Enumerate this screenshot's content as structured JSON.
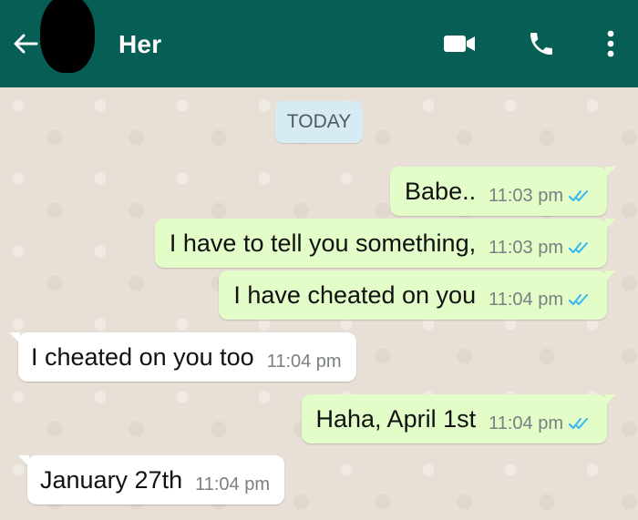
{
  "header": {
    "contact_name": "Her",
    "back_icon": "arrow-left-icon",
    "video_icon": "video-call-icon",
    "call_icon": "phone-icon",
    "menu_icon": "more-vertical-icon",
    "bar_color": "#075e54"
  },
  "chat": {
    "date_divider": "TODAY",
    "read_tick_color": "#34b7f1",
    "messages": [
      {
        "direction": "outgoing",
        "text": "Babe..",
        "time": "11:03 pm",
        "status": "read"
      },
      {
        "direction": "outgoing",
        "text": "I have to tell you something,",
        "time": "11:03 pm",
        "status": "read"
      },
      {
        "direction": "outgoing",
        "text": "I have cheated on you",
        "time": "11:04 pm",
        "status": "read"
      },
      {
        "direction": "incoming",
        "text": "I cheated on you too",
        "time": "11:04 pm"
      },
      {
        "direction": "outgoing",
        "text": "Haha, April 1st",
        "time": "11:04 pm",
        "status": "read"
      },
      {
        "direction": "incoming",
        "text": "January 27th",
        "time": "11:04 pm"
      }
    ]
  }
}
